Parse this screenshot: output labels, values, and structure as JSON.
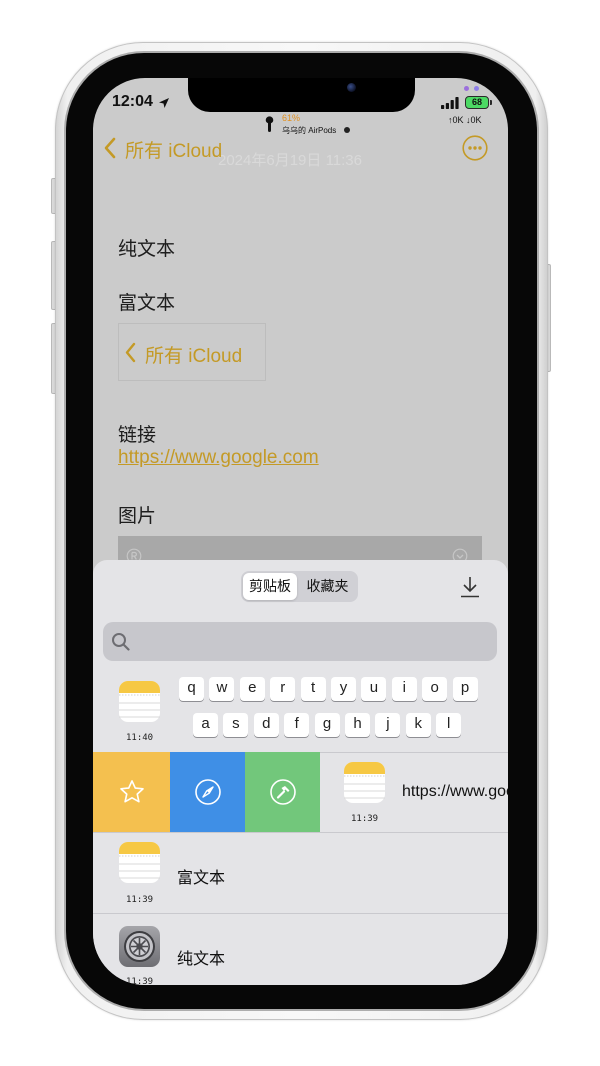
{
  "colors": {
    "accent_gold": "#c49a26",
    "note_background": "#cbcbcb",
    "sheet_background": "#e4e4e7",
    "airpods_battery": "#e3911f",
    "battery_fill": "#4cd964",
    "action_favorite": "#f4c04f",
    "action_open": "#3f8fe6",
    "action_edit": "#72c77b"
  },
  "status_bar": {
    "time": "12:04",
    "airpods_battery": "61%",
    "airpods_name": "乌乌的 AirPods",
    "battery_level": "68",
    "network_speed": "↑0K ↓0K",
    "icons": [
      "location-arrow-icon",
      "airpods-icon",
      "signal-icon",
      "battery-icon"
    ]
  },
  "nav": {
    "back_label": "所有 iCloud",
    "date": "2024年6月19日 11:36",
    "icons": [
      "chevron-left-icon",
      "more-icon"
    ]
  },
  "note": {
    "line1": "纯文本",
    "line2": "富文本",
    "embedded_back_label": "所有 iCloud",
    "link_heading": "链接",
    "link_url": "https://www.google.com",
    "image_heading": "图片"
  },
  "sheet": {
    "tabs": [
      {
        "label": "剪贴板",
        "selected": true
      },
      {
        "label": "收藏夹",
        "selected": false
      }
    ],
    "icons": [
      "download-icon",
      "search-icon"
    ],
    "items": [
      {
        "icon": "notes-icon",
        "time": "11:40",
        "keyboard_rows": [
          [
            "q",
            "w",
            "e",
            "r",
            "t",
            "y",
            "u",
            "i",
            "o",
            "p"
          ],
          [
            "a",
            "s",
            "d",
            "f",
            "g",
            "h",
            "j",
            "k",
            "l"
          ]
        ]
      },
      {
        "icon": "notes-icon",
        "time": "11:39",
        "text": "https://www.google.com",
        "swiped": true,
        "actions": [
          {
            "icon": "star-icon"
          },
          {
            "icon": "compass-icon"
          },
          {
            "icon": "hammer-icon"
          }
        ]
      },
      {
        "icon": "notes-icon",
        "time": "11:39",
        "text": "富文本"
      },
      {
        "icon": "settings-icon",
        "time": "11:39",
        "text": "纯文本"
      }
    ]
  }
}
